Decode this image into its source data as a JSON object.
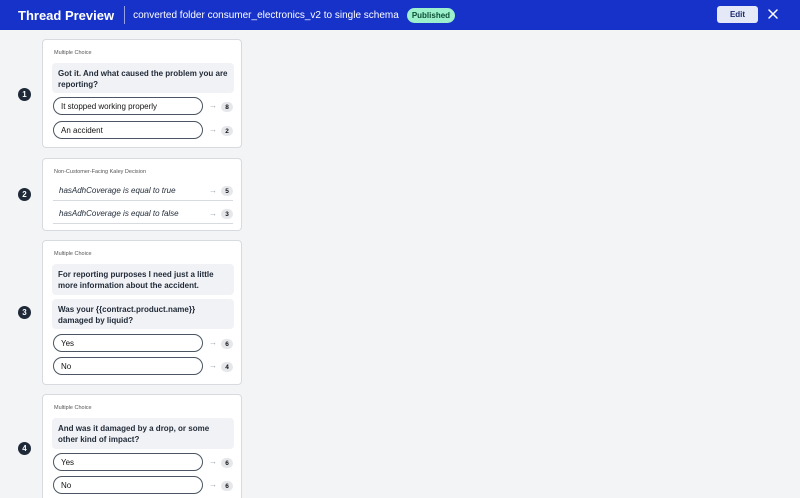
{
  "header": {
    "title": "Thread Preview",
    "subtitle": "converted folder consumer_electronics_v2 to single schema",
    "badge": "Published",
    "edit_label": "Edit",
    "close_icon": "close-icon"
  },
  "steps": [
    {
      "number": "1",
      "type": "Multiple Choice",
      "messages": [
        "Got it. And what caused the problem you are reporting?"
      ],
      "options": [
        {
          "label": "It stopped working properly",
          "target": "8"
        },
        {
          "label": "An accident",
          "target": "2"
        }
      ]
    },
    {
      "number": "2",
      "type": "Non-Customer-Facing Kaley Decision",
      "conditions": [
        {
          "label": "hasAdhCoverage is equal to true",
          "target": "5"
        },
        {
          "label": "hasAdhCoverage is equal to false",
          "target": "3"
        }
      ]
    },
    {
      "number": "3",
      "type": "Multiple Choice",
      "messages": [
        "For reporting purposes I need just a little more information about the accident.",
        "Was your {{contract.product.name}} damaged by liquid?"
      ],
      "options": [
        {
          "label": "Yes",
          "target": "6"
        },
        {
          "label": "No",
          "target": "4"
        }
      ]
    },
    {
      "number": "4",
      "type": "Multiple Choice",
      "messages": [
        "And was it damaged by a drop, or some other kind of impact?"
      ],
      "options": [
        {
          "label": "Yes",
          "target": "6"
        },
        {
          "label": "No",
          "target": "6"
        }
      ]
    }
  ]
}
